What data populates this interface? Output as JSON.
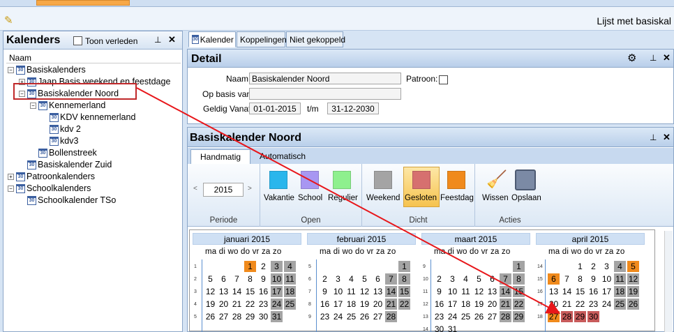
{
  "app": {
    "title": "Lijst met basiskal"
  },
  "left": {
    "title": "Kalenders",
    "toon_verleden": "Toon verleden",
    "col": "Naam",
    "tree": [
      {
        "label": "Basiskalenders",
        "level": 0,
        "exp": "−"
      },
      {
        "label": "Jaap Basis weekend en feestdage",
        "level": 1,
        "exp": "+"
      },
      {
        "label": "Basiskalender Noord",
        "level": 1,
        "exp": "−"
      },
      {
        "label": "Kennemerland",
        "level": 2,
        "exp": "−"
      },
      {
        "label": "KDV kennemerland",
        "level": 3,
        "exp": ""
      },
      {
        "label": "kdv 2",
        "level": 3,
        "exp": ""
      },
      {
        "label": "kdv3",
        "level": 3,
        "exp": ""
      },
      {
        "label": "Bollenstreek",
        "level": 2,
        "exp": ""
      },
      {
        "label": "Basiskalender Zuid",
        "level": 1,
        "exp": ""
      },
      {
        "label": "Patroonkalenders",
        "level": 0,
        "exp": "+"
      },
      {
        "label": "Schoolkalenders",
        "level": 0,
        "exp": "−"
      },
      {
        "label": "Schoolkalender TSo",
        "level": 1,
        "exp": ""
      }
    ]
  },
  "tabs": [
    "Kalender",
    "Koppelingen",
    "Niet gekoppeld"
  ],
  "detail": {
    "title": "Detail",
    "naam_label": "Naam:",
    "naam_value": "Basiskalender Noord",
    "patroon_label": "Patroon:",
    "opbasis_label": "Op basis van:",
    "geldig_label": "Geldig Vanaf:",
    "from": "01-01-2015",
    "tm": "t/m",
    "to": "31-12-2030"
  },
  "planner": {
    "title": "Basiskalender Noord",
    "tabs": [
      "Handmatig",
      "Automatisch"
    ],
    "year": "2015",
    "groups": {
      "periode": "Periode",
      "open": "Open",
      "dicht": "Dicht",
      "acties": "Acties"
    },
    "buttons": {
      "vakantie": "Vakantie",
      "school": "School",
      "regulier": "Regulier",
      "weekend": "Weekend",
      "gesloten": "Gesloten",
      "feestdag": "Feestdag",
      "wissen": "Wissen",
      "opslaan": "Opslaan"
    },
    "colors": {
      "vakantie": "#2ab6ec",
      "school": "#a897f2",
      "regulier": "#8ef08e",
      "weekend": "#a4a4a4",
      "gesloten": "#d6706f",
      "feestdag": "#f08a1c"
    }
  },
  "calendar": {
    "dow": "ma di wo do vr za zo",
    "months": [
      {
        "name": "januari 2015",
        "weeks": [
          {
            "wk": "1",
            "days": [
              "",
              "",
              "",
              "1",
              "2",
              "3",
              "4"
            ]
          },
          {
            "wk": "2",
            "days": [
              "5",
              "6",
              "7",
              "8",
              "9",
              "10",
              "11"
            ]
          },
          {
            "wk": "3",
            "days": [
              "12",
              "13",
              "14",
              "15",
              "16",
              "17",
              "18"
            ]
          },
          {
            "wk": "4",
            "days": [
              "19",
              "20",
              "21",
              "22",
              "23",
              "24",
              "25"
            ]
          },
          {
            "wk": "5",
            "days": [
              "26",
              "27",
              "28",
              "29",
              "30",
              "31",
              ""
            ]
          }
        ]
      },
      {
        "name": "februari 2015",
        "weeks": [
          {
            "wk": "5",
            "days": [
              "",
              "",
              "",
              "",
              "",
              "",
              "1"
            ]
          },
          {
            "wk": "6",
            "days": [
              "2",
              "3",
              "4",
              "5",
              "6",
              "7",
              "8"
            ]
          },
          {
            "wk": "7",
            "days": [
              "9",
              "10",
              "11",
              "12",
              "13",
              "14",
              "15"
            ]
          },
          {
            "wk": "8",
            "days": [
              "16",
              "17",
              "18",
              "19",
              "20",
              "21",
              "22"
            ]
          },
          {
            "wk": "9",
            "days": [
              "23",
              "24",
              "25",
              "26",
              "27",
              "28",
              ""
            ]
          }
        ]
      },
      {
        "name": "maart 2015",
        "weeks": [
          {
            "wk": "9",
            "days": [
              "",
              "",
              "",
              "",
              "",
              "",
              "1"
            ]
          },
          {
            "wk": "10",
            "days": [
              "2",
              "3",
              "4",
              "5",
              "6",
              "7",
              "8"
            ]
          },
          {
            "wk": "11",
            "days": [
              "9",
              "10",
              "11",
              "12",
              "13",
              "14",
              "15"
            ]
          },
          {
            "wk": "12",
            "days": [
              "16",
              "17",
              "18",
              "19",
              "20",
              "21",
              "22"
            ]
          },
          {
            "wk": "13",
            "days": [
              "23",
              "24",
              "25",
              "26",
              "27",
              "28",
              "29"
            ]
          },
          {
            "wk": "14",
            "days": [
              "30",
              "31",
              "",
              "",
              "",
              "",
              ""
            ]
          }
        ]
      },
      {
        "name": "april 2015",
        "weeks": [
          {
            "wk": "14",
            "days": [
              "",
              "",
              "1",
              "2",
              "3",
              "4",
              "5"
            ]
          },
          {
            "wk": "15",
            "days": [
              "6",
              "7",
              "8",
              "9",
              "10",
              "11",
              "12"
            ]
          },
          {
            "wk": "16",
            "days": [
              "13",
              "14",
              "15",
              "16",
              "17",
              "18",
              "19"
            ]
          },
          {
            "wk": "17",
            "days": [
              "20",
              "21",
              "22",
              "23",
              "24",
              "25",
              "26"
            ]
          },
          {
            "wk": "18",
            "days": [
              "27",
              "28",
              "29",
              "30",
              "",
              "",
              ""
            ]
          }
        ]
      }
    ],
    "holidays": {
      "0": [
        "1"
      ],
      "3": [
        "5",
        "6",
        "27"
      ]
    },
    "closed": {
      "3": [
        "28",
        "29",
        "30"
      ]
    }
  }
}
